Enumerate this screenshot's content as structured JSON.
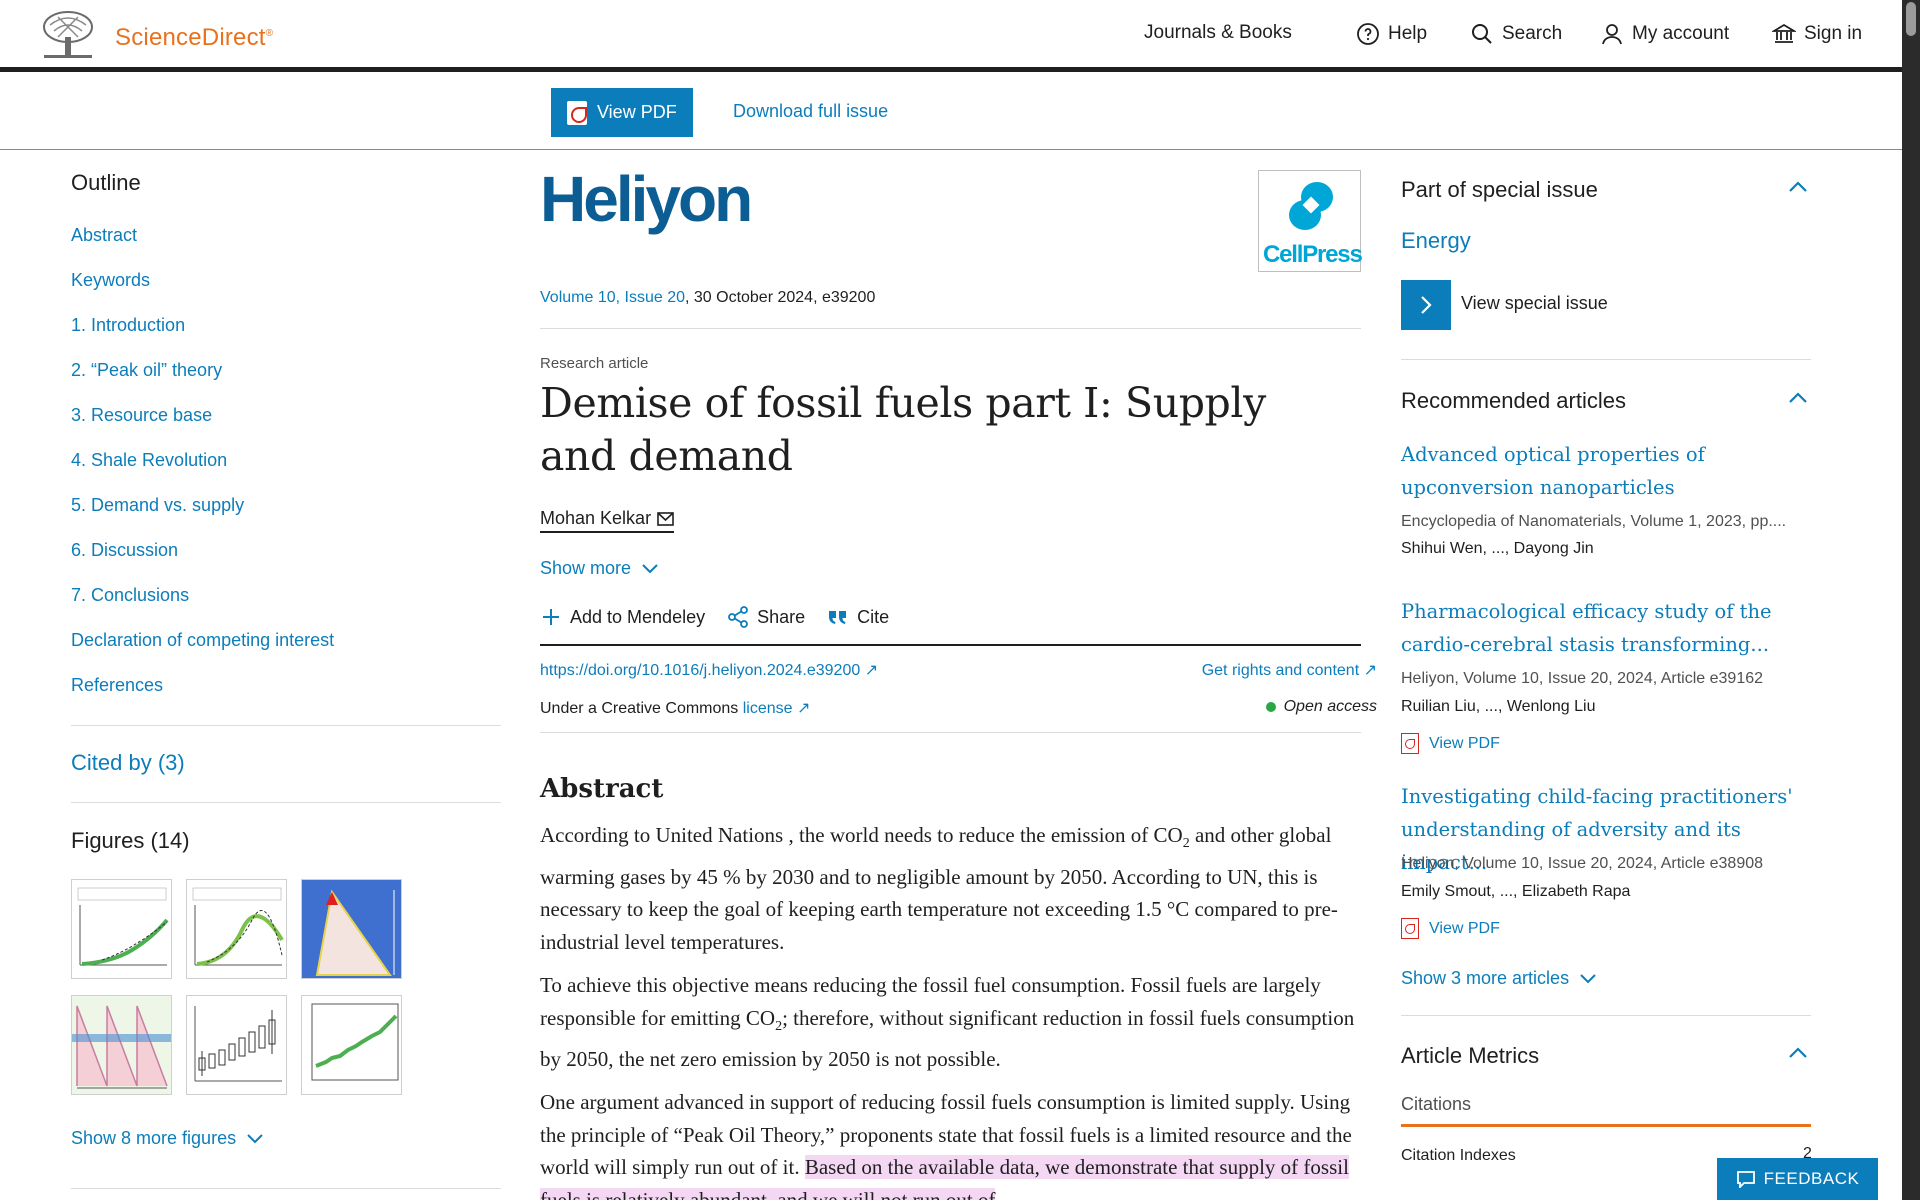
{
  "header": {
    "brand": "ScienceDirect",
    "brand_mark": "®",
    "nav": [
      "Journals & Books",
      "Help",
      "Search",
      "My account",
      "Sign in"
    ]
  },
  "toolbar": {
    "view_pdf": "View PDF",
    "download_issue": "Download full issue"
  },
  "outline": {
    "title": "Outline",
    "items": [
      "Abstract",
      "Keywords",
      "1. Introduction",
      "2. “Peak oil” theory",
      "3. Resource base",
      "4. Shale Revolution",
      "5. Demand vs. supply",
      "6. Discussion",
      "7. Conclusions",
      "Declaration of competing interest",
      "References"
    ],
    "cited_by": "Cited by (3)",
    "figures_title": "Figures (14)",
    "show_more_figures": "Show 8 more figures"
  },
  "article": {
    "journal": "Heliyon",
    "publisher_logo": "CellPress",
    "volume_link": "Volume 10, Issue 20",
    "volume_rest": ", 30 October 2024, e39200",
    "type": "Research article",
    "title": "Demise of fossil fuels part I: Supply and demand",
    "author": "Mohan Kelkar",
    "show_more": "Show more",
    "actions": [
      "Add to Mendeley",
      "Share",
      "Cite"
    ],
    "doi": "https://doi.org/10.1016/j.heliyon.2024.e39200",
    "rights": "Get rights and content",
    "cc_prefix": "Under a Creative Commons ",
    "cc_link": "license",
    "open_access": "Open access",
    "abstract_title": "Abstract",
    "p1_a": "According to United Nations , the world needs to reduce the emission of CO",
    "p1_sub": "2",
    "p1_b": " and other global warming gases by 45 % by 2030 and to negligible amount by 2050. According to UN, this is necessary to keep the goal of keeping earth temperature not exceeding 1.5 °C compared to pre-industrial level temperatures.",
    "p2_a": "To achieve this objective means reducing the fossil fuel consumption. Fossil fuels are largely responsible for emitting CO",
    "p2_sub": "2",
    "p2_b": "; therefore, without significant reduction in fossil fuels consumption by 2050, the net zero emission by 2050 is not possible.",
    "p3_a": "One argument advanced in support of reducing fossil fuels consumption is limited supply. Using the principle of “Peak Oil Theory,” proponents state that fossil fuels is a limited resource and the world will simply run out of it. ",
    "p3_hl": "Based on the available data, we demonstrate that supply of fossil fuels is relatively abundant, and we will not run out of"
  },
  "sidebar": {
    "special_issue_title": "Part of special issue",
    "special_issue_name": "Energy",
    "view_special_issue": "View special issue",
    "recommended_title": "Recommended articles",
    "recommended": [
      {
        "title": "Advanced optical properties of upconversion nanoparticles",
        "meta": "Encyclopedia of Nanomaterials, Volume 1, 2023, pp....",
        "authors": "Shihui Wen, ..., Dayong Jin",
        "pdf": ""
      },
      {
        "title": "Pharmacological efficacy study of the cardio-cerebral stasis transforming...",
        "meta": "Heliyon, Volume 10, Issue 20, 2024, Article e39162",
        "authors": "Ruilian Liu, ..., Wenlong Liu",
        "pdf": "View PDF"
      },
      {
        "title": "Investigating child-facing practitioners' understanding of adversity and its impact...",
        "meta": "Heliyon, Volume 10, Issue 20, 2024, Article e38908",
        "authors": "Emily Smout, ..., Elizabeth Rapa",
        "pdf": "View PDF"
      }
    ],
    "show_more_articles": "Show 3 more articles",
    "metrics_title": "Article Metrics",
    "metrics_tab": "Citations",
    "citation_indexes_label": "Citation Indexes",
    "citation_indexes_value": "2",
    "feedback": "FEEDBACK"
  },
  "colors": {
    "accent": "#0c7dbb",
    "brand": "#e9711c",
    "journal": "#0c5d93",
    "highlight": "#f3d7f3"
  }
}
